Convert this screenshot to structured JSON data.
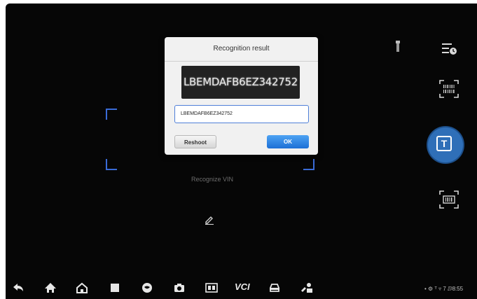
{
  "dialog": {
    "title": "Recognition result",
    "vin_image_text": "LBEMDAFB6EZ342752",
    "vin_value": "LBEMDAFB6EZ342752",
    "reshoot_label": "Reshoot",
    "ok_label": "OK"
  },
  "scanner": {
    "caption": "Recognize VIN"
  },
  "right_panel": {
    "text_mode_glyph": "T"
  },
  "navbar": {
    "vci_label": "VCI"
  },
  "status": {
    "text": "• ⚙ ᵀ ▿ 7 ⅅ8:55"
  },
  "colors": {
    "accent": "#2f6fb8",
    "frame": "#3a6bd6",
    "ok_button": "#1c6fd6"
  }
}
